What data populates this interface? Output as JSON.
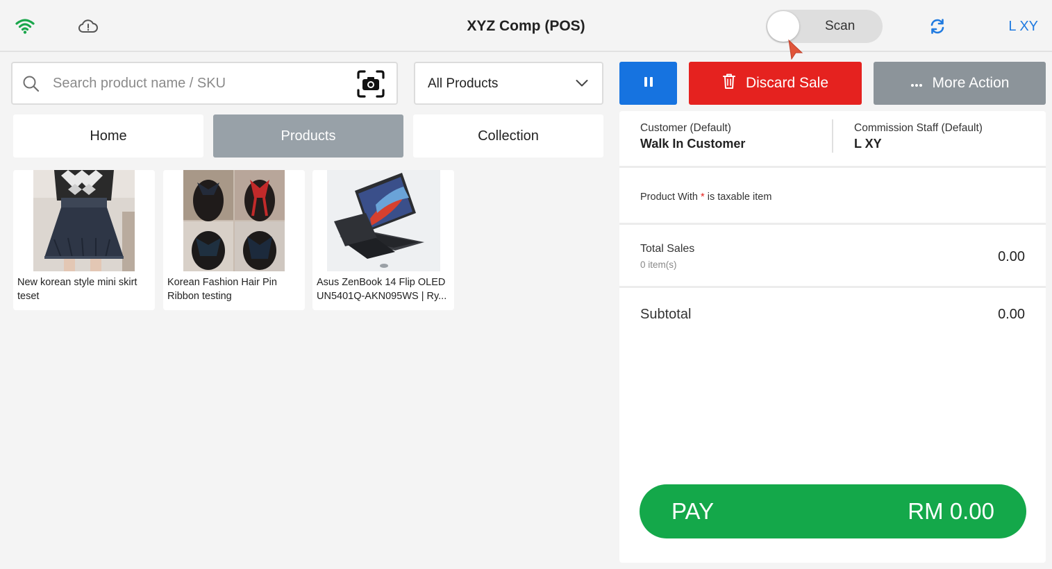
{
  "header": {
    "title": "XYZ Comp (POS)",
    "scan_label": "Scan",
    "user": "L XY",
    "icons": [
      "wifi-icon",
      "cloud-alert-icon",
      "sync-icon"
    ],
    "wifi_color": "#1aa64b",
    "accent_color": "#1f7ae0"
  },
  "search": {
    "placeholder": "Search product name / SKU",
    "value": ""
  },
  "filter": {
    "selected": "All Products"
  },
  "tabs": [
    {
      "label": "Home",
      "active": false
    },
    {
      "label": "Products",
      "active": true
    },
    {
      "label": "Collection",
      "active": false
    }
  ],
  "products": [
    {
      "name": "New korean style mini skirt teset"
    },
    {
      "name": "Korean Fashion Hair Pin Ribbon testing"
    },
    {
      "name": "Asus ZenBook 14 Flip OLED UN5401Q-AKN095WS | Ry..."
    }
  ],
  "actions": {
    "discard_label": "Discard Sale",
    "more_label": "More Action",
    "pause_color": "#1673e0",
    "discard_color": "#e5221f",
    "more_color": "#8c949a"
  },
  "cart": {
    "customer_label": "Customer  (Default)",
    "customer_value": "Walk In Customer",
    "staff_label": "Commission Staff  (Default)",
    "staff_value": "L XY",
    "tax_note_prefix": "Product With",
    "tax_note_star": "*",
    "tax_note_suffix": "is taxable item",
    "total_sales_label": "Total Sales",
    "items_count": "0 item(s)",
    "total_sales_value": "0.00",
    "subtotal_label": "Subtotal",
    "subtotal_value": "0.00"
  },
  "pay": {
    "label": "PAY",
    "amount": "RM 0.00",
    "color": "#14a84a"
  }
}
